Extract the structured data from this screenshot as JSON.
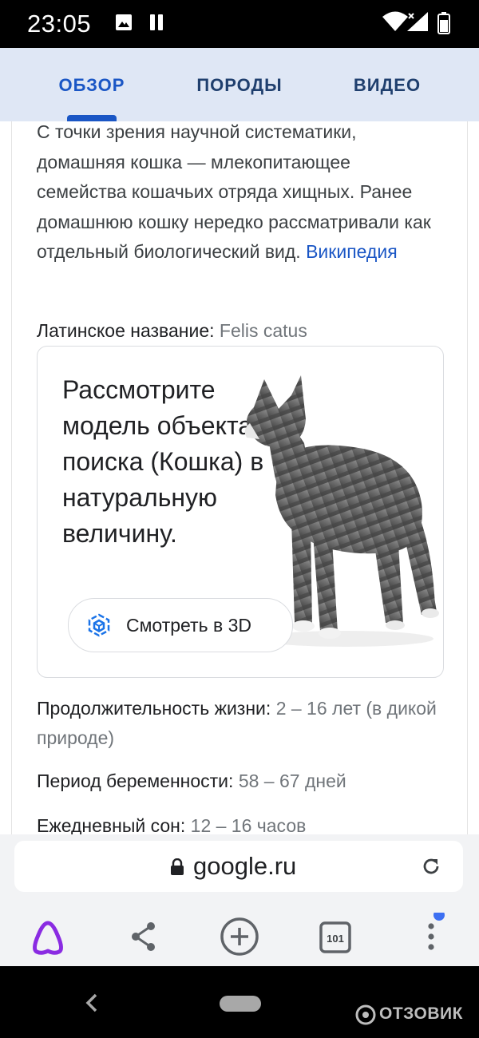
{
  "status_bar": {
    "time": "23:05"
  },
  "tabs": [
    {
      "label": "ОБЗОР"
    },
    {
      "label": "ПОРОДЫ"
    },
    {
      "label": "ВИДЕО"
    }
  ],
  "description": {
    "text": "С точки зрения научной систематики, домашняя кошка — млекопитающее семейства кошачьих отряда хищных. Ранее домашнюю кошку нередко рассматривали как отдельный биологический вид.",
    "source_link": "Википедия"
  },
  "latin_name": {
    "label": "Латинское название:",
    "value": "Felis catus"
  },
  "model_card": {
    "text": "Рассмотрите модель объекта поиска (Кошка) в натуральную величину.",
    "button_label": "Смотреть в 3D"
  },
  "facts": [
    {
      "label": "Продолжительность жизни:",
      "value": "2 – 16 лет (в дикой природе)"
    },
    {
      "label": "Период беременности:",
      "value": "58 – 67 дней"
    },
    {
      "label": "Ежедневный сон:",
      "value": "12 – 16 часов"
    }
  ],
  "browser": {
    "url": "google.ru",
    "tabs_count": "101"
  },
  "watermark": "ОТЗОВИК",
  "colors": {
    "accent": "#1a56c5",
    "tab_background": "#dfe7f5",
    "alice_purple": "#8a2be2",
    "notification_dot": "#3d6ff2"
  }
}
